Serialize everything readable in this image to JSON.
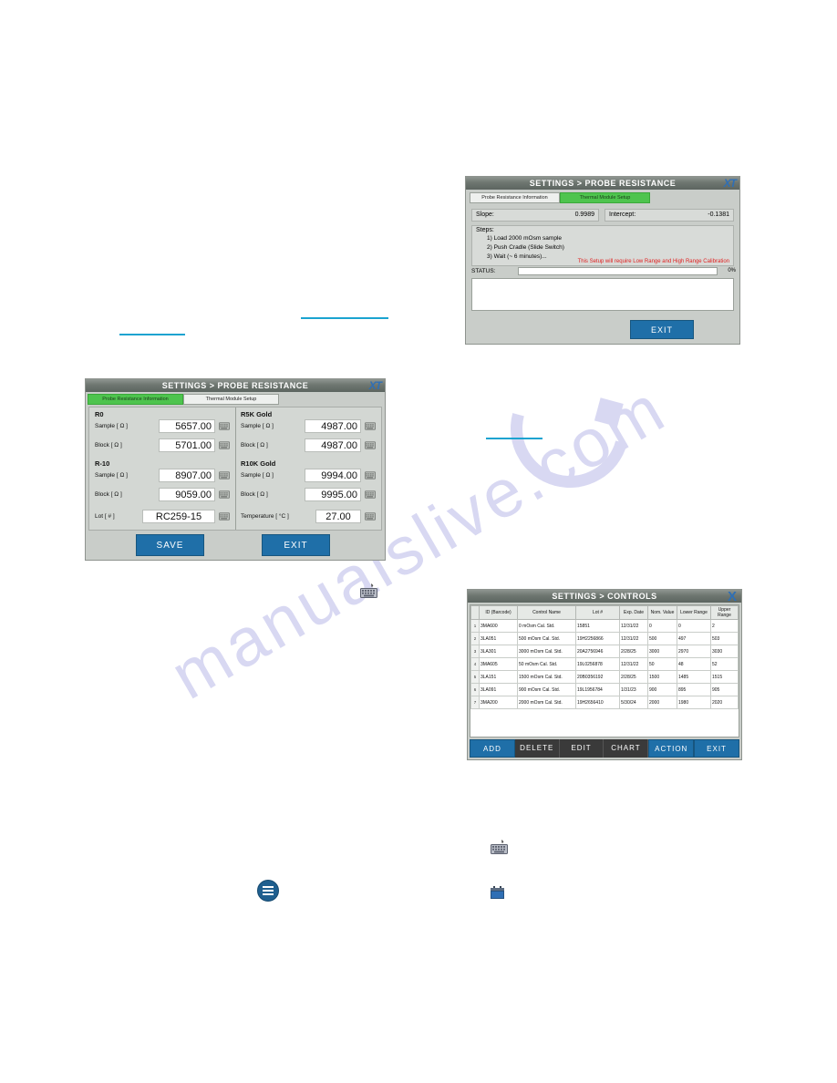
{
  "page": {
    "watermark": "manualslive.com",
    "watermark_logo": "arc-diamond-logo"
  },
  "link_rules": [
    {
      "name": "link-underline-1"
    },
    {
      "name": "link-underline-2"
    },
    {
      "name": "link-underline-3"
    }
  ],
  "probe_resistance": {
    "title": "SETTINGS > PROBE RESISTANCE",
    "brand": "XT",
    "tabs": [
      {
        "label": "Probe Resistance Information",
        "active": true
      },
      {
        "label": "Thermal Module Setup",
        "active": false
      }
    ],
    "groups": {
      "r0": {
        "name": "R0",
        "sample_label": "Sample [ Ω ]",
        "sample_value": "5657.00",
        "block_label": "Block [ Ω ]",
        "block_value": "5701.00"
      },
      "r10": {
        "name": "R-10",
        "sample_label": "Sample [ Ω ]",
        "sample_value": "8907.00",
        "block_label": "Block [ Ω ]",
        "block_value": "9059.00"
      },
      "r5k": {
        "name": "R5K Gold",
        "sample_label": "Sample [ Ω ]",
        "sample_value": "4987.00",
        "block_label": "Block [ Ω ]",
        "block_value": "4987.00"
      },
      "r10k": {
        "name": "R10K Gold",
        "sample_label": "Sample [ Ω ]",
        "sample_value": "9994.00",
        "block_label": "Block [ Ω ]",
        "block_value": "9995.00"
      }
    },
    "lot_label": "Lot [ # ]",
    "lot_value": "RC259-15",
    "temperature_label": "Temperature [ °C ]",
    "temperature_value": "27.00",
    "save_label": "SAVE",
    "exit_label": "EXIT",
    "keyboard_icon": "keyboard-icon"
  },
  "thermal_module": {
    "title": "SETTINGS > PROBE RESISTANCE",
    "brand": "XT",
    "tabs": [
      {
        "label": "Probe Resistance Information",
        "active": false
      },
      {
        "label": "Thermal Module Setup",
        "active": true
      }
    ],
    "slope_label": "Slope:",
    "slope_value": "0.9989",
    "intercept_label": "Intercept:",
    "intercept_value": "-0.1381",
    "steps_header": "Steps:",
    "steps": [
      "1) Load 2000 mOsm sample",
      "2) Push Cradle (Slide Switch)",
      "3) Wait (~ 6 minutes)..."
    ],
    "warning": "This Setup will require Low Range and High Range Calibration",
    "status_label": "STATUS:",
    "progress_percent": "0%",
    "progress_value": 0,
    "log_text": "",
    "exit_label": "EXIT"
  },
  "controls": {
    "title": "SETTINGS > CONTROLS",
    "close_label": "X",
    "columns": [
      "ID (Barcode)",
      "Control Name",
      "Lot #",
      "Exp. Date",
      "Nom. Value",
      "Lower Range",
      "Upper Range"
    ],
    "rows": [
      {
        "n": "1",
        "id": "3MA600",
        "name": "0 mOsm Cal. Std.",
        "lot": "15851",
        "exp": "12/31/22",
        "nom": "0",
        "lower": "0",
        "upper": "2"
      },
      {
        "n": "2",
        "id": "3LA051",
        "name": "500 mOsm Cal. Std.",
        "lot": "19H2256866",
        "exp": "12/31/22",
        "nom": "500",
        "lower": "497",
        "upper": "503"
      },
      {
        "n": "3",
        "id": "3LA301",
        "name": "3000 mOsm Cal. Std.",
        "lot": "20A2756946",
        "exp": "2/28/25",
        "nom": "3000",
        "lower": "2970",
        "upper": "3030"
      },
      {
        "n": "4",
        "id": "3MA605",
        "name": "50 mOsm Cal. Std.",
        "lot": "19L0256878",
        "exp": "12/31/22",
        "nom": "50",
        "lower": "48",
        "upper": "52"
      },
      {
        "n": "5",
        "id": "3LA151",
        "name": "1500 mOsm Cal. Std.",
        "lot": "20B0356192",
        "exp": "2/28/25",
        "nom": "1500",
        "lower": "1485",
        "upper": "1515"
      },
      {
        "n": "6",
        "id": "3LA091",
        "name": "900 mOsm Cal. Std.",
        "lot": "19L1956784",
        "exp": "1/31/23",
        "nom": "900",
        "lower": "895",
        "upper": "905"
      },
      {
        "n": "7",
        "id": "3MA200",
        "name": "2000 mOsm Cal. Std.",
        "lot": "19H2656410",
        "exp": "5/30/24",
        "nom": "2000",
        "lower": "1980",
        "upper": "2020"
      }
    ],
    "buttons": [
      {
        "label": "ADD",
        "style": "blue"
      },
      {
        "label": "DELETE",
        "style": "grey"
      },
      {
        "label": "EDIT",
        "style": "grey"
      },
      {
        "label": "CHART",
        "style": "grey"
      },
      {
        "label": "ACTION",
        "style": "blue"
      },
      {
        "label": "EXIT",
        "style": "blue"
      }
    ]
  },
  "page_icons": {
    "keyboard_a": "keyboard-icon",
    "menu_circle": "menu-list-icon",
    "keyboard_b": "keyboard-icon",
    "calendar": "calendar-icon"
  }
}
